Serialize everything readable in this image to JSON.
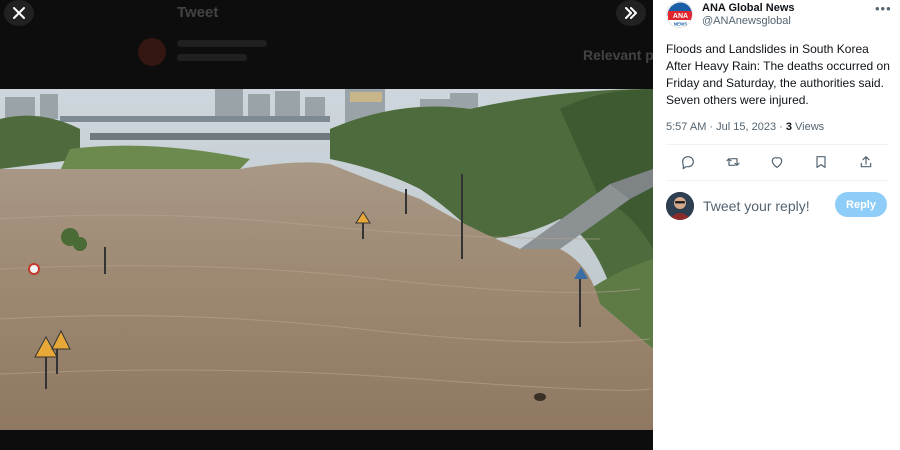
{
  "background_tweet": {
    "title": "Tweet",
    "related_label": "Relevant p"
  },
  "viewer": {
    "close_icon": "close-icon",
    "expand_icon": "double-chevron-right-icon"
  },
  "tweet": {
    "author_name": "ANA Global News",
    "author_handle": "@ANAnewsglobal",
    "logo_text": "ANA",
    "logo_subtext": "NEWS",
    "text": "Floods and Landslides in South Korea After Heavy Rain: The deaths occurred on Friday and Saturday, the authorities said. Seven others were injured.",
    "time": "5:57 AM · Jul 15, 2023 · ",
    "views_count": "3",
    "views_label": " Views"
  },
  "actions": [
    "reply-icon",
    "retweet-icon",
    "like-icon",
    "bookmark-icon",
    "share-icon"
  ],
  "reply": {
    "placeholder": "Tweet your reply!",
    "button_label": "Reply"
  },
  "colors": {
    "reply_button": "#8ecdf8",
    "logo_red": "#e3262e",
    "logo_blue": "#1a5fa8"
  }
}
